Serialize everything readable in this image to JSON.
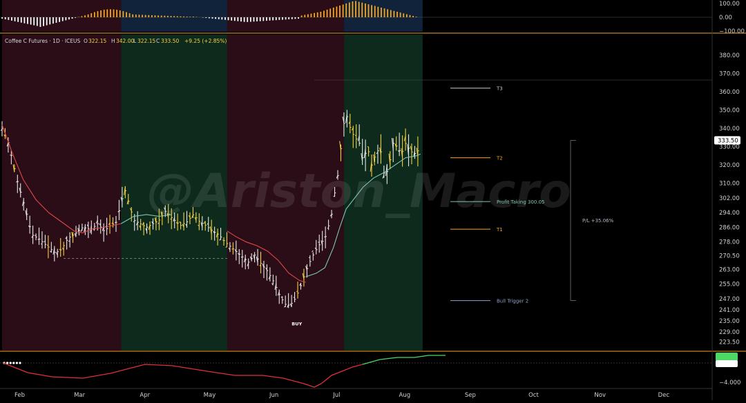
{
  "header": {
    "symbol": "Coffee C Futures · 1D · ICEUS",
    "o_label": "O",
    "o_value": "322.15",
    "h_label": "H",
    "h_value": "342.00",
    "l_label": "L",
    "l_value": "322.15",
    "c_label": "C",
    "c_value": "333.50",
    "change": "+9.25 (+2.85%)"
  },
  "watermark": "@Ariston_Macro",
  "colors": {
    "background": "#000000",
    "bull_zone": "#0d2a1c",
    "bear_zone": "#2a0d16",
    "candle_yellow": "#f5d142",
    "candle_white": "#e8e8e8",
    "ema_red": "#e04848",
    "ema_teal": "#7ec8b8",
    "orange": "#f5a623",
    "histogram_orange": "#f5a623",
    "histogram_white": "#ffffff",
    "lower_green": "#4cd964",
    "lower_red": "#e0303a"
  },
  "chart_data": {
    "type": "candlestick",
    "ylim": [
      220,
      385
    ],
    "yticks": [
      "380.00",
      "370.00",
      "360.00",
      "350.00",
      "340.00",
      "330.00",
      "320.00",
      "310.00",
      "302.00",
      "294.00",
      "286.00",
      "278.00",
      "270.50",
      "263.00",
      "255.00",
      "247.00",
      "241.00",
      "235.00",
      "229.00",
      "223.50"
    ],
    "y_tick_values": [
      380,
      370,
      360,
      350,
      340,
      330,
      320,
      310,
      302,
      294,
      286,
      278,
      270.5,
      263,
      255,
      247,
      241,
      235,
      229,
      223.5
    ],
    "current_price": "333.50",
    "x_months": [
      "Feb",
      "Mar",
      "Apr",
      "May",
      "Jun",
      "Jul",
      "Aug",
      "Sep",
      "Oct",
      "Nov",
      "Dec"
    ],
    "x_month_day": [
      0,
      28,
      59,
      89,
      120,
      150,
      181,
      212,
      242,
      273,
      303
    ],
    "zones": [
      {
        "type": "bear",
        "start_day": 0,
        "end_day": 56
      },
      {
        "type": "bull",
        "start_day": 56,
        "end_day": 106
      },
      {
        "type": "bear",
        "start_day": 106,
        "end_day": 161
      },
      {
        "type": "bull",
        "start_day": 161,
        "end_day": 198
      }
    ],
    "price_path": [
      [
        0,
        340
      ],
      [
        3,
        332
      ],
      [
        7,
        312
      ],
      [
        11,
        296
      ],
      [
        14,
        282
      ],
      [
        17,
        280
      ],
      [
        21,
        276
      ],
      [
        25,
        272
      ],
      [
        28,
        274
      ],
      [
        31,
        280
      ],
      [
        35,
        283
      ],
      [
        38,
        286
      ],
      [
        42,
        285
      ],
      [
        45,
        288
      ],
      [
        48,
        284
      ],
      [
        51,
        287
      ],
      [
        54,
        289
      ],
      [
        56,
        300
      ],
      [
        58,
        306
      ],
      [
        60,
        298
      ],
      [
        62,
        290
      ],
      [
        65,
        288
      ],
      [
        68,
        286
      ],
      [
        71,
        288
      ],
      [
        74,
        290
      ],
      [
        77,
        295
      ],
      [
        80,
        291
      ],
      [
        84,
        287
      ],
      [
        87,
        289
      ],
      [
        90,
        293
      ],
      [
        93,
        289
      ],
      [
        96,
        287
      ],
      [
        99,
        284
      ],
      [
        102,
        282
      ],
      [
        105,
        278
      ],
      [
        107,
        276
      ],
      [
        110,
        273
      ],
      [
        113,
        270
      ],
      [
        116,
        267
      ],
      [
        119,
        271
      ],
      [
        122,
        266
      ],
      [
        125,
        262
      ],
      [
        128,
        256
      ],
      [
        131,
        248
      ],
      [
        134,
        243
      ],
      [
        137,
        245
      ],
      [
        140,
        252
      ],
      [
        143,
        262
      ],
      [
        146,
        270
      ],
      [
        149,
        276
      ],
      [
        152,
        280
      ],
      [
        155,
        292
      ],
      [
        157,
        308
      ],
      [
        159,
        320
      ],
      [
        160,
        338
      ],
      [
        162,
        348
      ],
      [
        164,
        340
      ],
      [
        166,
        335
      ],
      [
        168,
        333
      ],
      [
        170,
        322
      ],
      [
        172,
        330
      ],
      [
        174,
        320
      ],
      [
        176,
        326
      ],
      [
        178,
        330
      ],
      [
        180,
        314
      ],
      [
        182,
        318
      ],
      [
        184,
        332
      ],
      [
        186,
        330
      ],
      [
        188,
        326
      ],
      [
        190,
        332
      ],
      [
        192,
        328
      ],
      [
        194,
        326
      ],
      [
        196,
        328
      ],
      [
        197,
        333.5
      ]
    ],
    "ema_red": {
      "name": "",
      "points": [
        [
          0,
          342
        ],
        [
          5,
          326
        ],
        [
          10,
          312
        ],
        [
          16,
          301
        ],
        [
          22,
          294
        ],
        [
          28,
          289
        ],
        [
          34,
          284
        ],
        [
          38,
          283
        ],
        [
          42,
          285
        ],
        [
          48,
          286
        ],
        [
          56,
          288
        ]
      ]
    },
    "ema_red_2": {
      "points": [
        [
          106,
          284
        ],
        [
          110,
          281
        ],
        [
          115,
          278
        ],
        [
          120,
          276
        ],
        [
          125,
          273
        ],
        [
          130,
          268
        ],
        [
          135,
          261
        ],
        [
          140,
          257
        ],
        [
          143,
          256
        ]
      ]
    },
    "ema_teal": {
      "points": [
        [
          56,
          288
        ],
        [
          62,
          292
        ],
        [
          68,
          293
        ],
        [
          74,
          292
        ],
        [
          80,
          293
        ]
      ]
    },
    "ema_teal_2": {
      "points": [
        [
          143,
          259
        ],
        [
          148,
          261
        ],
        [
          152,
          264
        ],
        [
          156,
          275
        ],
        [
          159,
          286
        ],
        [
          162,
          296
        ],
        [
          166,
          302
        ],
        [
          170,
          308
        ],
        [
          175,
          313
        ],
        [
          180,
          316
        ],
        [
          185,
          320
        ],
        [
          190,
          324
        ],
        [
          195,
          325
        ],
        [
          197,
          326
        ]
      ]
    },
    "support_line": {
      "value": 269,
      "start_day": 29,
      "end_day": 106
    },
    "levels": [
      {
        "label": "T3",
        "value": 362,
        "color": "#cccccc"
      },
      {
        "label": "T2",
        "value": 324,
        "color": "#f5a623"
      },
      {
        "label": "Profit Taking 300.05",
        "value": 300.05,
        "color": "#7ec8b8"
      },
      {
        "label": "T1",
        "value": 285,
        "color": "#f5a623"
      },
      {
        "label": "Bull Trigger 2",
        "value": 246,
        "color": "#8ca0c8"
      }
    ],
    "buy_label": {
      "text": "BUY",
      "day": 137,
      "value": 240
    },
    "pl_label": "P/L +35.06%",
    "pl_range": [
      246,
      333.5
    ],
    "upper_panel": {
      "yticks": [
        "100.00",
        "0.00",
        "−100.00"
      ],
      "y_tick_values": [
        100,
        0,
        -100
      ]
    },
    "lower_panel": {
      "ytick": "−4.000"
    }
  }
}
